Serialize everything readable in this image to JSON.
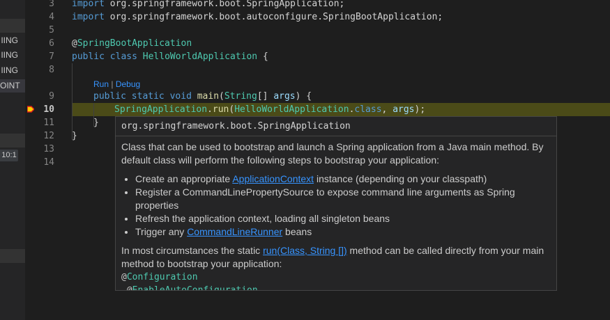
{
  "left_panel": {
    "rows": [
      "IING",
      "IING",
      "IING",
      "OINT"
    ],
    "badge": "10:1"
  },
  "gutter": {
    "line_numbers": [
      "3",
      "4",
      "5",
      "6",
      "7",
      "8",
      "9",
      "10",
      "11",
      "12",
      "13",
      "14"
    ],
    "active_line": "10"
  },
  "code": {
    "line3": {
      "kw": "import",
      "rest": " org.springframework.boot.SpringApplication;"
    },
    "line4": {
      "kw": "import",
      "rest": " org.springframework.boot.autoconfigure.SpringBootApplication;"
    },
    "line6": {
      "at": "@",
      "ann": "SpringBootApplication"
    },
    "line7": {
      "kw1": "public",
      "kw2": "class",
      "cls": "HelloWorldApplication",
      "rest": " {"
    },
    "codelens": {
      "run": "Run",
      "sep": " | ",
      "debug": "Debug"
    },
    "line9": {
      "kw1": "public",
      "kw2": "static",
      "kw3": "void",
      "fn": "main",
      "p1": "(",
      "type": "String",
      "p2": "[] ",
      "var": "args",
      "p3": ") {"
    },
    "line10": {
      "cls": "SpringApplication",
      "p1": ".",
      "fn": "run",
      "p2": "(",
      "cls2": "HelloWorldApplication",
      "p3": ".",
      "kw": "class",
      "p4": ", ",
      "var": "args",
      "p5": ");"
    },
    "line11": "}",
    "line12": "}"
  },
  "hover": {
    "header": "org.springframework.boot.SpringApplication",
    "p1": "Class that can be used to bootstrap and launch a Spring application from a Java main method. By default class will perform the following steps to bootstrap your application:",
    "li1_pre": "Create an appropriate ",
    "li1_link": "ApplicationContext",
    "li1_post": " instance (depending on your classpath)",
    "li2": "Register a CommandLinePropertySource to expose command line arguments as Spring properties",
    "li3": "Refresh the application context, loading all singleton beans",
    "li4_pre": "Trigger any ",
    "li4_link": "CommandLineRunner",
    "li4_post": " beans",
    "p2_pre": "In most circumstances the static ",
    "p2_link": "run(Class, String [])",
    "p2_post": " method can be called directly from your main method to bootstrap your application:",
    "code1_at": "@",
    "code1": "Configuration",
    "code2_at": " @",
    "code2": "EnableAutoConfiguration"
  },
  "colors": {
    "editor_bg": "#1e1e1e",
    "keyword": "#569cd6",
    "type": "#4ec9b0",
    "function": "#dcdcaa",
    "variable": "#9cdcfe",
    "link": "#3794ff",
    "current_line": "#4b4b18"
  }
}
